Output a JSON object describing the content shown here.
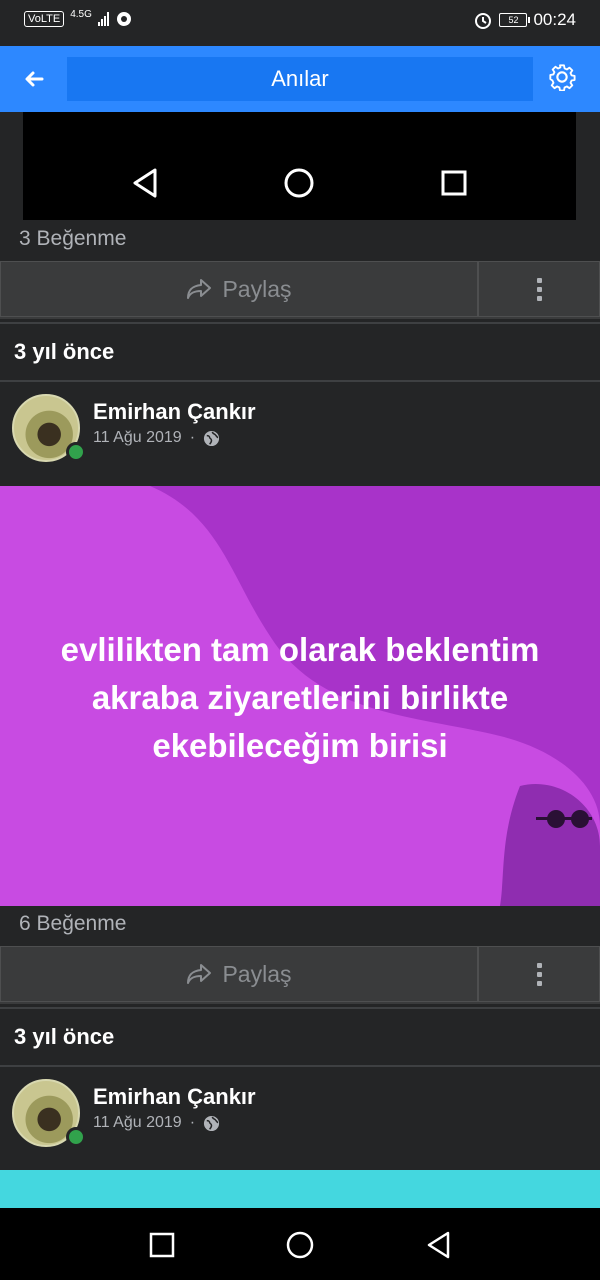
{
  "status_bar": {
    "volte": "VoLTE",
    "network": "4.5G",
    "battery": "52",
    "time": "00:24"
  },
  "header": {
    "title": "Anılar"
  },
  "memories": [
    {
      "likes": "3 Beğenme",
      "share_label": "Paylaş"
    },
    {
      "time_ago": "3 yıl önce",
      "author": "Emirhan Çankır",
      "date": "11 Ağu 2019",
      "separator": "·",
      "post_text": "evlilikten tam olarak beklentim akraba ziyaretlerini birlikte ekebileceğim birisi",
      "post_background": "#c84be2",
      "likes": "6 Beğenme",
      "share_label": "Paylaş"
    },
    {
      "time_ago": "3 yıl önce",
      "author": "Emirhan Çankır",
      "date": "11 Ağu 2019",
      "separator": "·",
      "post_background": "#44d7df"
    }
  ],
  "icons": {
    "back": "arrow-left-icon",
    "settings": "gear-icon",
    "share": "share-arrow-icon",
    "more": "more-vertical-icon",
    "privacy": "globe-icon"
  },
  "colors": {
    "accent": "#2d88ff",
    "online": "#31a24c"
  }
}
